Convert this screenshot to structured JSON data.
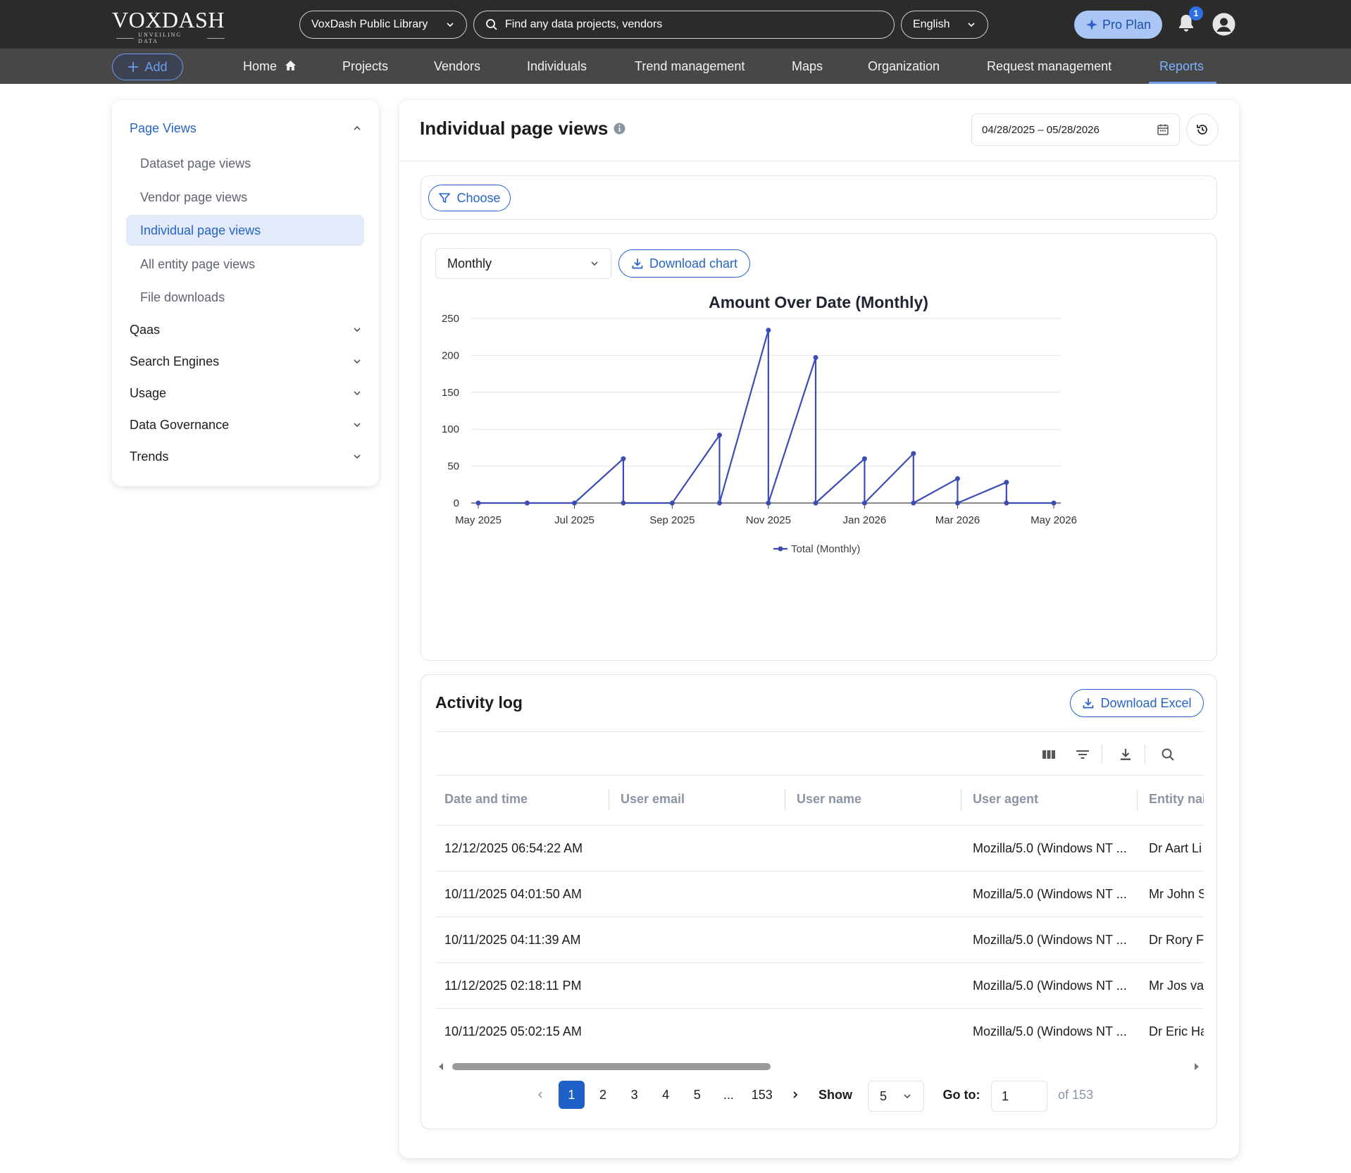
{
  "brand": {
    "name": "VOXDASH",
    "tagline": "UNVEILING DATA"
  },
  "header": {
    "library": "VoxDash Public Library",
    "search_placeholder": "Find any data projects, vendors",
    "language": "English",
    "pro_plan": "Pro Plan",
    "notification_count": "1"
  },
  "nav": {
    "add": "Add",
    "items": [
      "Home",
      "Projects",
      "Vendors",
      "Individuals",
      "Trend management",
      "Maps",
      "Organization",
      "Request management",
      "Reports"
    ],
    "active": "Reports"
  },
  "sidebar": {
    "groups": [
      {
        "label": "Page Views",
        "open": true,
        "items": [
          "Dataset page views",
          "Vendor page views",
          "Individual page views",
          "All entity page views",
          "File downloads"
        ],
        "active_item": "Individual page views"
      },
      {
        "label": "Qaas",
        "open": false
      },
      {
        "label": "Search Engines",
        "open": false
      },
      {
        "label": "Usage",
        "open": false
      },
      {
        "label": "Data Governance",
        "open": false
      },
      {
        "label": "Trends",
        "open": false
      }
    ]
  },
  "main": {
    "title": "Individual page views",
    "date_range": "04/28/2025 – 05/28/2026",
    "choose": "Choose",
    "period": "Monthly",
    "download_chart": "Download chart"
  },
  "chart_data": {
    "type": "line",
    "title": "Amount Over Date (Monthly)",
    "x_ticks": [
      "May 2025",
      "Jul 2025",
      "Sep 2025",
      "Nov 2025",
      "Jan 2026",
      "Mar 2026",
      "May 2026"
    ],
    "y_ticks": [
      0,
      50,
      100,
      150,
      200,
      250
    ],
    "ylim": [
      0,
      250
    ],
    "grid": true,
    "legend": "bottom-center",
    "color": "#3b4db5",
    "series": [
      {
        "name": "Total (Monthly)",
        "points": [
          [
            "2025-05-01",
            0
          ],
          [
            "2025-06-01",
            0
          ],
          [
            "2025-07-01",
            0
          ],
          [
            "2025-08-01",
            60
          ],
          [
            "2025-08-01",
            0
          ],
          [
            "2025-09-01",
            0
          ],
          [
            "2025-10-01",
            92
          ],
          [
            "2025-10-01",
            0
          ],
          [
            "2025-11-01",
            234
          ],
          [
            "2025-11-01",
            0
          ],
          [
            "2025-12-01",
            197
          ],
          [
            "2025-12-01",
            0
          ],
          [
            "2026-01-01",
            60
          ],
          [
            "2026-01-01",
            0
          ],
          [
            "2026-02-01",
            67
          ],
          [
            "2026-02-01",
            0
          ],
          [
            "2026-03-01",
            33
          ],
          [
            "2026-03-01",
            0
          ],
          [
            "2026-04-01",
            28
          ],
          [
            "2026-04-01",
            0
          ],
          [
            "2026-05-01",
            0
          ]
        ]
      }
    ]
  },
  "activity": {
    "title": "Activity log",
    "download_excel": "Download Excel",
    "columns": [
      "Date and time",
      "User email",
      "User name",
      "User agent",
      "Entity nai"
    ],
    "rows": [
      [
        "12/12/2025 06:54:22 AM",
        "",
        "",
        "Mozilla/5.0 (Windows NT ...",
        "Dr Aart Li"
      ],
      [
        "10/11/2025 04:01:50 AM",
        "",
        "",
        "Mozilla/5.0 (Windows NT ...",
        "Mr John S"
      ],
      [
        "10/11/2025 04:11:39 AM",
        "",
        "",
        "Mozilla/5.0 (Windows NT ...",
        "Dr Rory F"
      ],
      [
        "11/12/2025 02:18:11 PM",
        "",
        "",
        "Mozilla/5.0 (Windows NT ...",
        "Mr Jos va"
      ],
      [
        "10/11/2025 05:02:15 AM",
        "",
        "",
        "Mozilla/5.0 (Windows NT ...",
        "Dr Eric Ha"
      ]
    ]
  },
  "pagination": {
    "pages": [
      "1",
      "2",
      "3",
      "4",
      "5",
      "...",
      "153"
    ],
    "current": "1",
    "show_label": "Show",
    "page_size": "5",
    "goto_label": "Go to:",
    "goto_value": "1",
    "of_total": "of 153"
  }
}
